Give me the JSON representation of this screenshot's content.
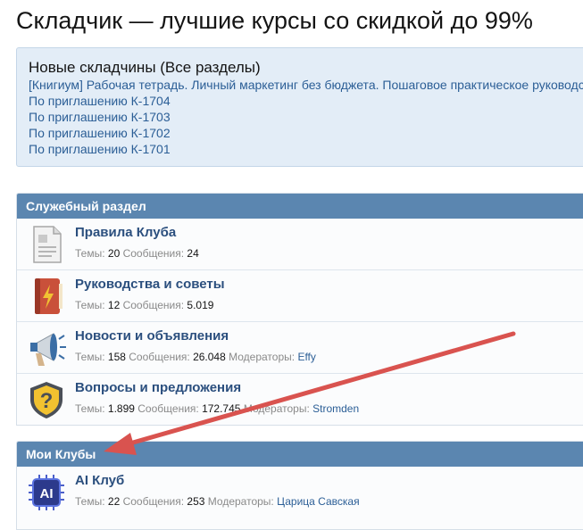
{
  "page": {
    "title": "Складчик — лучшие курсы со скидкой до 99%"
  },
  "notice": {
    "title": "Новые складчины (Все разделы)",
    "links": [
      "[Книгиум] Рабочая тетрадь. Личный маркетинг без бюджета. Пошаговое практическое руководство",
      "По приглашению К-1704",
      "По приглашению К-1703",
      "По приглашению К-1702",
      "По приглашению К-1701"
    ]
  },
  "sections": [
    {
      "header": "Служебный раздел",
      "nodes": [
        {
          "title": "Правила Клуба",
          "icon": "document-icon",
          "topics_label": "Темы:",
          "topics": "20",
          "messages_label": "Сообщения:",
          "messages": "24"
        },
        {
          "title": "Руководства и советы",
          "icon": "book-icon",
          "topics_label": "Темы:",
          "topics": "12",
          "messages_label": "Сообщения:",
          "messages": "5.019"
        },
        {
          "title": "Новости и объявления",
          "icon": "megaphone-icon",
          "topics_label": "Темы:",
          "topics": "158",
          "messages_label": "Сообщения:",
          "messages": "26.048",
          "moderators_label": "Модераторы:",
          "moderators": "Effy"
        },
        {
          "title": "Вопросы и предложения",
          "icon": "question-shield-icon",
          "topics_label": "Темы:",
          "topics": "1.899",
          "messages_label": "Сообщения:",
          "messages": "172.745",
          "moderators_label": "Модераторы:",
          "moderators": "Stromden"
        }
      ]
    },
    {
      "header": "Мои Клубы",
      "nodes": [
        {
          "title": "AI Клуб",
          "icon": "ai-chip-icon",
          "icon_text": "AI",
          "topics_label": "Темы:",
          "topics": "22",
          "messages_label": "Сообщения:",
          "messages": "253",
          "moderators_label": "Модераторы:",
          "moderators": "Царица Савская"
        }
      ]
    }
  ],
  "colors": {
    "header": "#5b86b0",
    "link": "#2b5e96",
    "node_title": "#2b4f7e",
    "arrow": "#d9534f",
    "notice_bg": "#e3edf7"
  }
}
